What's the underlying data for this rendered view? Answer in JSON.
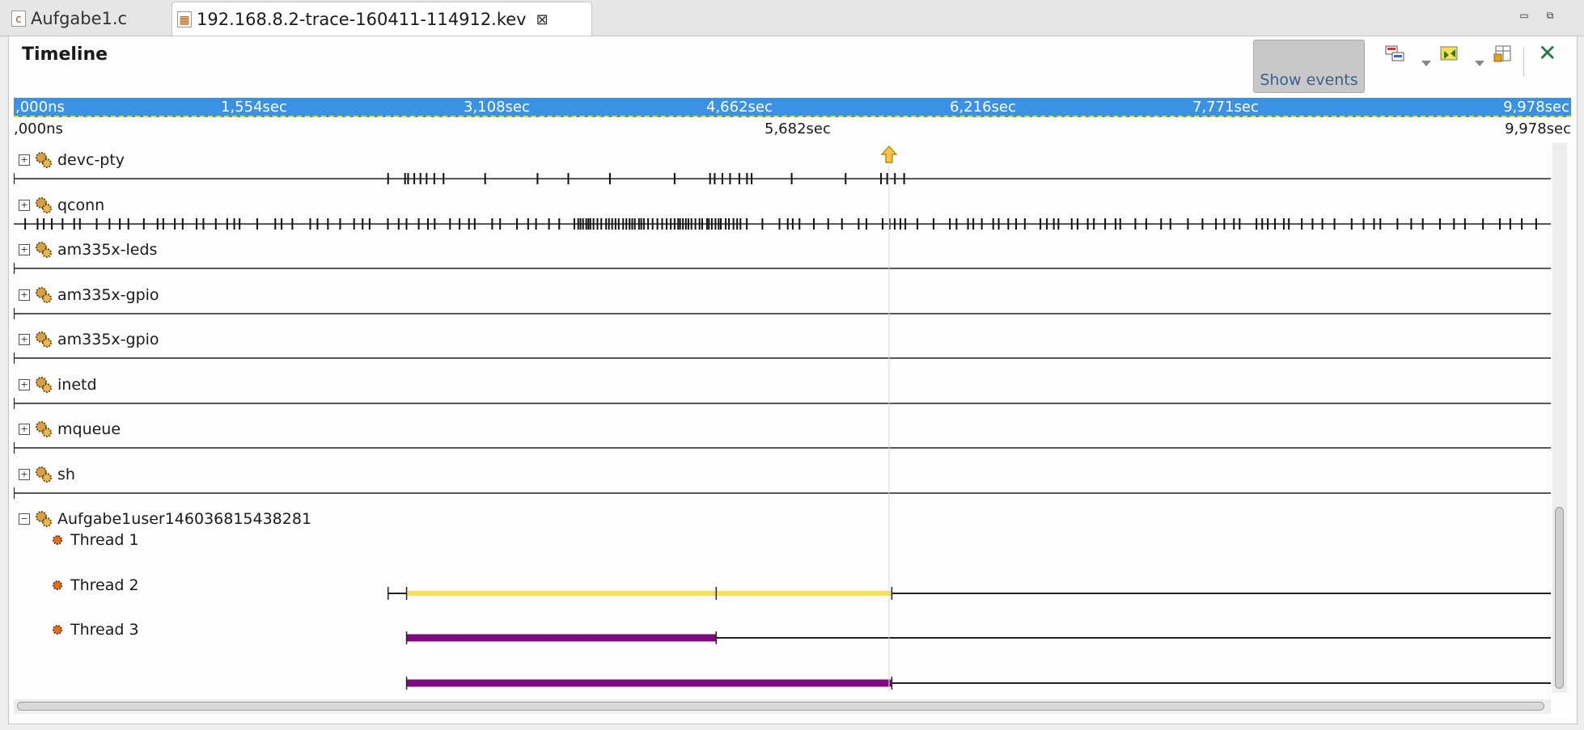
{
  "tabs": [
    {
      "label": "Aufgabe1.c",
      "icon": "c-source-file-icon"
    },
    {
      "label": "192.168.8.2-trace-160411-114912.kev",
      "icon": "trace-log-file-icon",
      "active": true
    }
  ],
  "window_controls": [
    "minimize-icon",
    "restore-icon"
  ],
  "panel": {
    "title": "Timeline",
    "show_events_label": "Show events",
    "toolbar_icons": [
      "filter-icon",
      "zoom-icon",
      "lock-icon",
      "close-icon"
    ]
  },
  "ruler": {
    "ticks": [
      ",000ns",
      "1,554sec",
      "3,108sec",
      "4,662sec",
      "6,216sec",
      "7,771sec",
      "9,978sec"
    ],
    "start": ",000ns",
    "middle": "5,682sec",
    "end": "9,978sec",
    "total_seconds": 9.978
  },
  "cursor": {
    "time_seconds": 5.682,
    "icon": "cursor-marker-icon"
  },
  "processes": [
    {
      "name": "devc-pty",
      "expanded": false,
      "events": [
        0.0,
        2.43,
        2.54,
        2.56,
        2.6,
        2.64,
        2.68,
        2.73,
        2.79,
        3.06,
        3.4,
        3.6,
        3.87,
        4.29,
        4.52,
        4.55,
        4.6,
        4.65,
        4.71,
        4.76,
        4.79,
        5.05,
        5.4,
        5.63,
        5.67,
        5.72,
        5.78
      ]
    },
    {
      "name": "qconn",
      "expanded": false,
      "dense_events": true
    },
    {
      "name": "am335x-leds",
      "expanded": false,
      "events": [
        0.0
      ]
    },
    {
      "name": "am335x-gpio",
      "expanded": false,
      "events": [
        0.0
      ]
    },
    {
      "name": "am335x-gpio",
      "expanded": false,
      "events": [
        0.0
      ]
    },
    {
      "name": "inetd",
      "expanded": false,
      "events": [
        0.0
      ]
    },
    {
      "name": "mqueue",
      "expanded": false,
      "events": [
        0.0
      ]
    },
    {
      "name": "sh",
      "expanded": false,
      "events": [
        0.0
      ]
    },
    {
      "name": "Aufgabe1user146036815438281",
      "expanded": true,
      "threads": [
        {
          "name": "Thread 1",
          "start": 2.43,
          "active_start": 2.55,
          "active_end": 5.7,
          "marks": [
            2.43,
            2.55,
            4.56,
            5.7
          ],
          "color": "#f5e05a"
        },
        {
          "name": "Thread 2",
          "start": 2.55,
          "active_start": 2.55,
          "active_end": 4.56,
          "marks": [
            2.55,
            4.56
          ],
          "color": "#7d0b7d"
        },
        {
          "name": "Thread 3",
          "start": 2.55,
          "active_start": 2.55,
          "active_end": 5.7,
          "marks": [
            2.55,
            5.7
          ],
          "color": "#7d0b7d"
        }
      ]
    }
  ],
  "colors": {
    "ruler_bg": "#3b92e5",
    "ruler_border": "#e8e000",
    "close_x": "#1e7a3c",
    "thread_running": "#f5e05a",
    "thread_blocked": "#7d0b7d"
  }
}
